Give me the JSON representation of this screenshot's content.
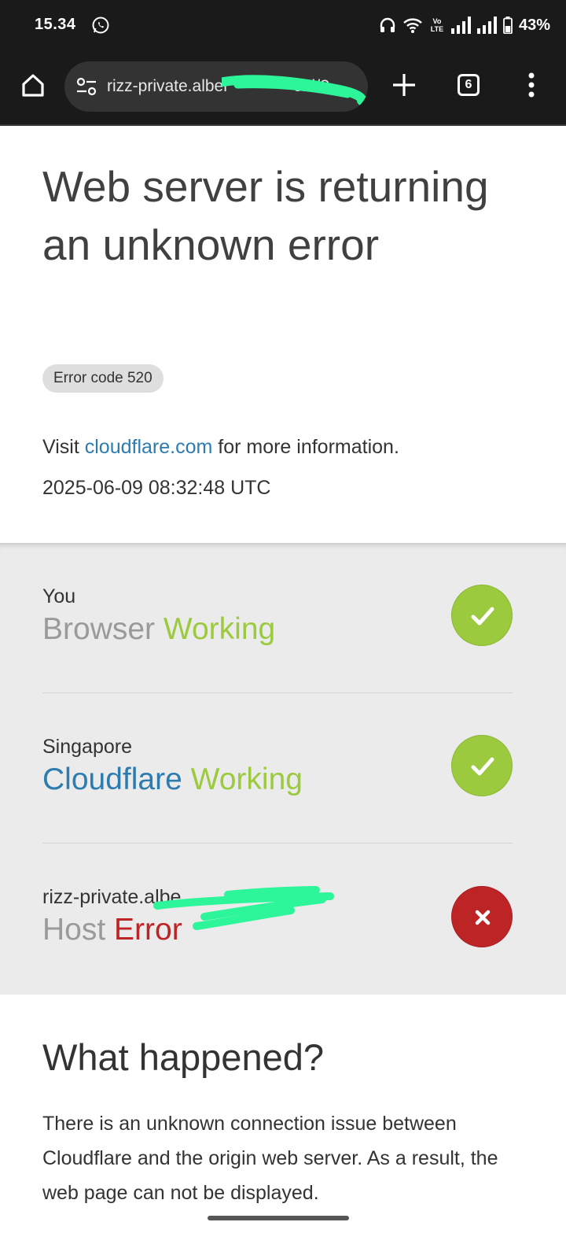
{
  "status_bar": {
    "time": "15.34",
    "network_label": "Vo LTE",
    "battery": "43%"
  },
  "browser": {
    "url": "rizz-private.alber",
    "url_tail": "cfd/?_",
    "tab_count": "6"
  },
  "page": {
    "title": "Web server is returning an unknown error",
    "error_code": "Error code 520",
    "visit_prefix": "Visit ",
    "visit_link": "cloudflare.com",
    "visit_suffix": " for more information.",
    "timestamp": "2025-06-09 08:32:48 UTC"
  },
  "status_rows": [
    {
      "location": "You",
      "label": "Browser",
      "status": "Working",
      "state": "ok"
    },
    {
      "location": "Singapore",
      "label": "Cloudflare",
      "status": "Working",
      "state": "ok"
    },
    {
      "location": "rizz-private.albe",
      "label": "Host",
      "status": "Error",
      "state": "error"
    }
  ],
  "what_happened": {
    "title": "What happened?",
    "text": "There is an unknown connection issue between Cloudflare and the origin web server. As a result, the web page can not be displayed."
  },
  "colors": {
    "ok": "#9bca3e",
    "error": "#bd2426",
    "link": "#2c7cb0",
    "redaction": "#2cf59a"
  },
  "icons": {
    "home": "home-icon",
    "site_info": "tune-icon",
    "new_tab": "plus-icon",
    "menu": "more-vert-icon",
    "ok": "check-icon",
    "error": "close-icon"
  }
}
